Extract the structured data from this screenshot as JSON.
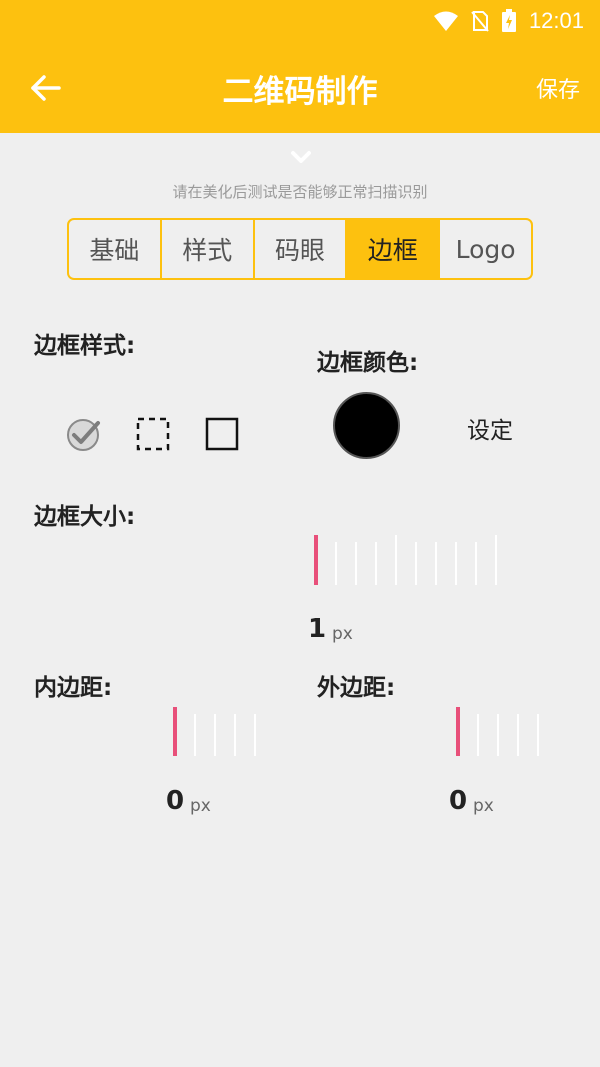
{
  "status": {
    "time": "12:01"
  },
  "header": {
    "title": "二维码制作",
    "save_label": "保存"
  },
  "hint": "请在美化后测试是否能够正常扫描识别",
  "tabs": [
    {
      "label": "基础",
      "active": false
    },
    {
      "label": "样式",
      "active": false
    },
    {
      "label": "码眼",
      "active": false
    },
    {
      "label": "边框",
      "active": true
    },
    {
      "label": "Logo",
      "active": false
    }
  ],
  "border_style": {
    "label": "边框样式:",
    "options": [
      "none-checked",
      "dashed",
      "solid"
    ],
    "selected": "none-checked"
  },
  "border_color": {
    "label": "边框颜色:",
    "color": "#000000",
    "set_label": "设定"
  },
  "border_size": {
    "label": "边框大小:",
    "value": "1",
    "unit": "px"
  },
  "padding": {
    "label": "内边距:",
    "value": "0",
    "unit": "px"
  },
  "margin": {
    "label": "外边距:",
    "value": "0",
    "unit": "px"
  },
  "colors": {
    "accent": "#fdc10f",
    "indicator": "#e8507a"
  }
}
